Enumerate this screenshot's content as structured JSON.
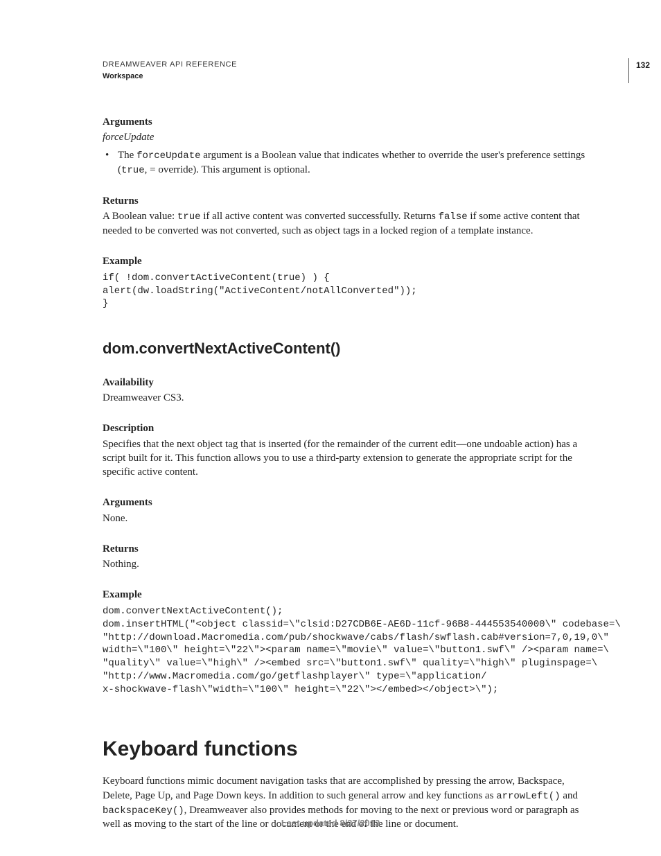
{
  "header": {
    "title": "DREAMWEAVER API REFERENCE",
    "section": "Workspace",
    "page_number": "132"
  },
  "sec1": {
    "arguments_h": "Arguments",
    "arguments_param": "forceUpdate",
    "bullet_pre": "The ",
    "bullet_code1": "forceUpdate",
    "bullet_mid": " argument is a Boolean value that indicates whether to override the user's preference settings (",
    "bullet_code2": "true",
    "bullet_post": ", = override). This argument is optional.",
    "returns_h": "Returns",
    "returns_pre": "A Boolean value: ",
    "returns_code1": "true",
    "returns_mid": " if all active content was converted successfully. Returns ",
    "returns_code2": "false",
    "returns_post": " if some active content that needed to be converted was not converted, such as object tags in a locked region of a template instance.",
    "example_h": "Example",
    "example_code": "if( !dom.convertActiveContent(true) ) {\nalert(dw.loadString(\"ActiveContent/notAllConverted\"));\n}"
  },
  "sec2": {
    "title": "dom.convertNextActiveContent()",
    "availability_h": "Availability",
    "availability_txt": "Dreamweaver CS3.",
    "description_h": "Description",
    "description_txt": "Specifies that the next object tag that is inserted (for the remainder of the current edit—one undoable action) has a script built for it. This function allows you to use a third-party extension to generate the appropriate script for the specific active content.",
    "arguments_h": "Arguments",
    "arguments_txt": "None.",
    "returns_h": "Returns",
    "returns_txt": "Nothing.",
    "example_h": "Example",
    "example_code": "dom.convertNextActiveContent();\ndom.insertHTML(\"<object classid=\\\"clsid:D27CDB6E-AE6D-11cf-96B8-444553540000\\\" codebase=\\\n\"http://download.Macromedia.com/pub/shockwave/cabs/flash/swflash.cab#version=7,0,19,0\\\"\nwidth=\\\"100\\\" height=\\\"22\\\"><param name=\\\"movie\\\" value=\\\"button1.swf\\\" /><param name=\\\n\"quality\\\" value=\\\"high\\\" /><embed src=\\\"button1.swf\\\" quality=\\\"high\\\" pluginspage=\\\n\"http://www.Macromedia.com/go/getflashplayer\\\" type=\\\"application/\nx-shockwave-flash\\\"width=\\\"100\\\" height=\\\"22\\\"></embed></object>\\\");"
  },
  "sec3": {
    "title": "Keyboard functions",
    "para_pre": "Keyboard functions mimic document navigation tasks that are accomplished by pressing the arrow, Backspace, Delete, Page Up, and Page Down keys. In addition to such general arrow and key functions as ",
    "code1": "arrowLeft()",
    "para_mid": " and ",
    "code2": "backspaceKey()",
    "para_post": ", Dreamweaver also provides methods for moving to the next or previous word or paragraph as well as moving to the start of the line or document or the end of the line or document."
  },
  "footer": {
    "text": "Last updated 8/27/2013"
  }
}
